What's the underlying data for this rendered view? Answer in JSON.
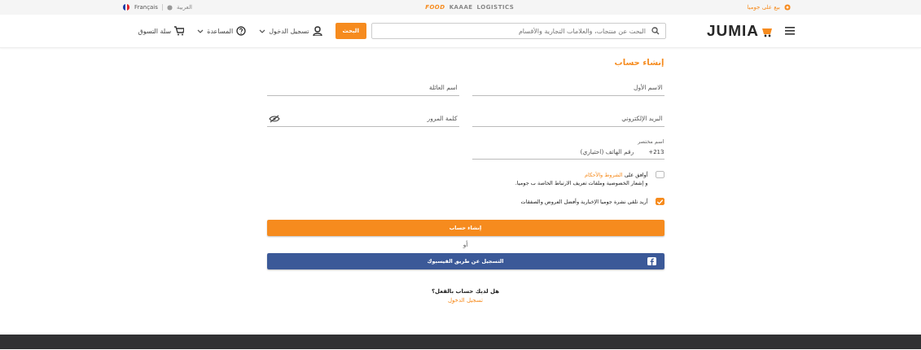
{
  "top_bar": {
    "sell_link": "بيع على جوميا",
    "partners": [
      {
        "label": "LOGISTICS",
        "kind": "logistics"
      },
      {
        "label": "KAAAE",
        "kind": "kaaae"
      },
      {
        "label": "FOOD",
        "kind": "food"
      }
    ],
    "language_current": "العربية",
    "language_other": "Français"
  },
  "header": {
    "logo": "JUMIA",
    "search": {
      "placeholder": "البحث عن منتجات، والعلامات التجارية والأقسام"
    },
    "search_button": "البحث",
    "account": "تسجيل الدخول",
    "help": "المساعدة",
    "cart": "سلة التسوق"
  },
  "form": {
    "title": "إنشاء حساب",
    "fields": [
      {
        "kind": "text",
        "placeholder": "الاسم الأول"
      },
      {
        "kind": "text",
        "placeholder": "اسم العائلة"
      },
      {
        "kind": "text",
        "placeholder": "البريد الإلكتروني"
      },
      {
        "kind": "password",
        "placeholder": "كلمة المرور"
      }
    ],
    "phone": {
      "prefix_label": "اسم مختصر",
      "prefix": "+213",
      "placeholder": "رقم الهاتف (اختياري)"
    },
    "terms": {
      "checked": false,
      "before": "أوافق على",
      "link": "الشروط والأحكام",
      "after": "و إشعار الخصوصية وملفات تعريف الارتباط الخاصة ب جوميا."
    },
    "newsletter": {
      "checked": true,
      "label": "أريد تلقي نشرة جوميا الإخبارية وأفضل العروض والصفقات"
    },
    "submit": "إنشاء حساب",
    "or": "أو",
    "facebook": "التسجيل عن طريق الفيسبوك",
    "have_account": "هل لديك حساب بالفعل؟",
    "login_link": "تسجيل الدخول"
  }
}
